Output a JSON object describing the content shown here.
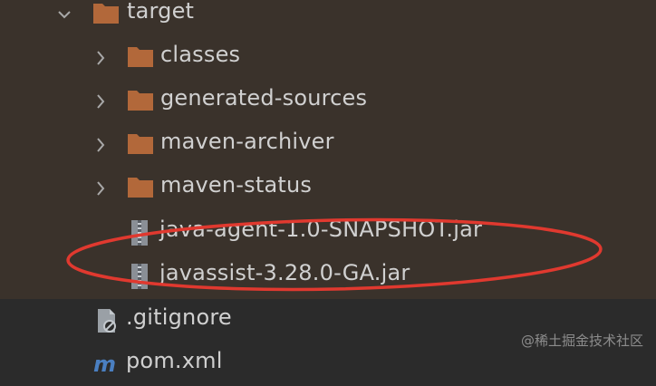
{
  "tree": {
    "target": {
      "label": "target",
      "expanded": true,
      "icon": "folder-icon",
      "chevron": "chevron-down-icon"
    },
    "items": [
      {
        "label": "classes",
        "type": "folder",
        "icon": "folder-icon",
        "chevron": "chevron-right-icon"
      },
      {
        "label": "generated-sources",
        "type": "folder",
        "icon": "folder-icon",
        "chevron": "chevron-right-icon"
      },
      {
        "label": "maven-archiver",
        "type": "folder",
        "icon": "folder-icon",
        "chevron": "chevron-right-icon"
      },
      {
        "label": "maven-status",
        "type": "folder",
        "icon": "folder-icon",
        "chevron": "chevron-right-icon"
      },
      {
        "label": "java-agent-1.0-SNAPSHOT.jar",
        "type": "jar",
        "icon": "jar-archive-icon"
      },
      {
        "label": "javassist-3.28.0-GA.jar",
        "type": "jar",
        "icon": "jar-archive-icon"
      }
    ],
    "root_files": [
      {
        "label": ".gitignore",
        "icon": "ignored-file-icon"
      },
      {
        "label": "pom.xml",
        "icon": "maven-pom-icon"
      }
    ]
  },
  "annotation": {
    "shape": "oval",
    "color": "#e0392f",
    "highlighted": [
      "java-agent-1.0-SNAPSHOT.jar",
      "javassist-3.28.0-GA.jar"
    ]
  },
  "watermark": "@稀土掘金技术社区",
  "colors": {
    "folder": "#b2683a",
    "text": "#d0d0d0",
    "background_selected": "#3a322b",
    "background": "#2b2b2b",
    "chevron": "#a8a8a8",
    "annotation": "#e0392f"
  }
}
